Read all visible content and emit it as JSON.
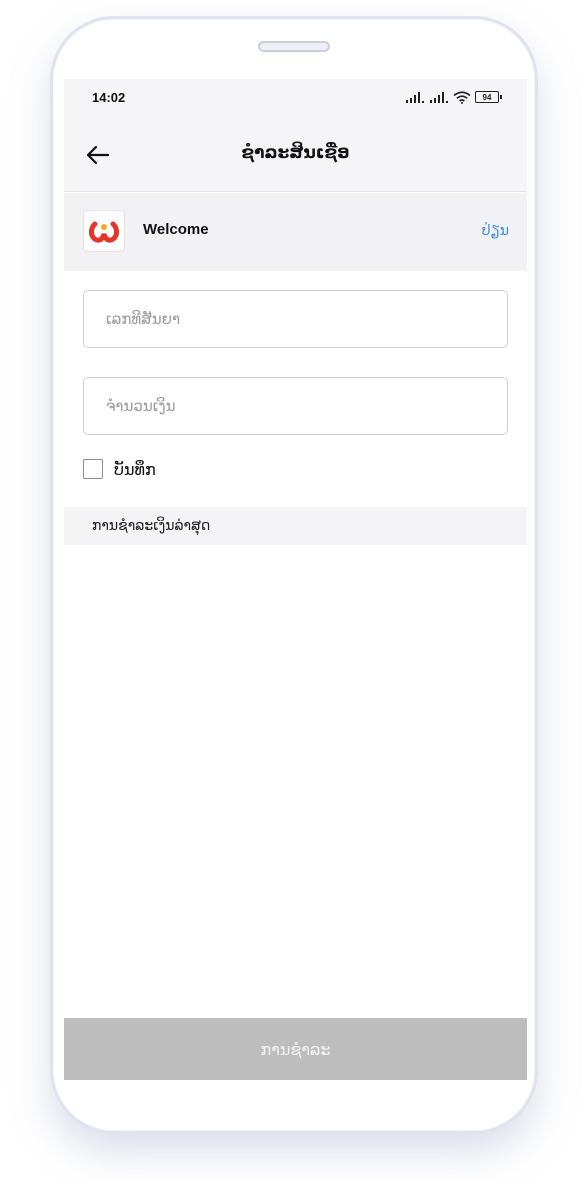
{
  "status_bar": {
    "time": "14:02",
    "battery": "94"
  },
  "header": {
    "title": "ຊຳລະສິນເຊື່ອ"
  },
  "merchant": {
    "name": "Welcome",
    "edit_label": "ປ່ຽນ"
  },
  "form": {
    "contract_placeholder": "ເລກທີສັນຍາ",
    "amount_placeholder": "ຈຳນວນເງິນ",
    "save_label": "ບັນທຶກ",
    "save_checked": false
  },
  "recent": {
    "label": "ການຊຳລະເງິນລ່າສຸດ"
  },
  "footer": {
    "pay_label": "ການຊຳລະ"
  },
  "colors": {
    "accent": "#3d8cd6",
    "button_disabled": "#bdbdbd",
    "logo_red": "#e5352b",
    "logo_orange": "#f5a623"
  }
}
